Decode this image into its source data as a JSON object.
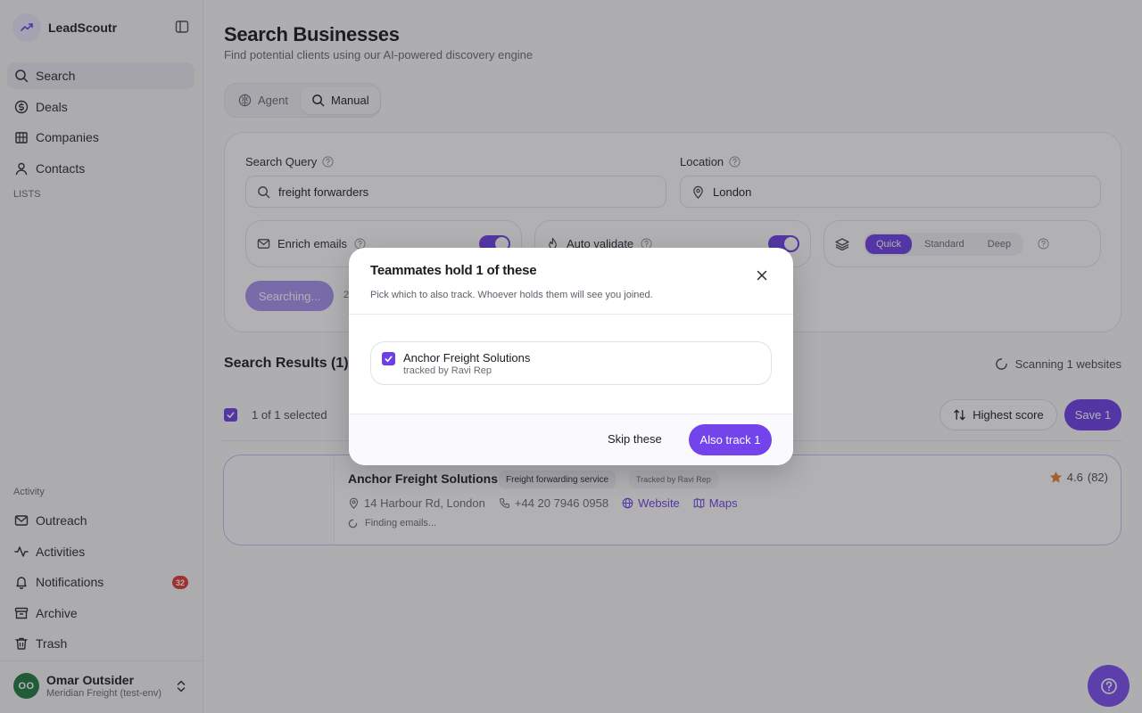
{
  "app": {
    "name": "LeadScoutr"
  },
  "sidebar": {
    "nav": [
      {
        "label": "Search",
        "icon": "search-icon"
      },
      {
        "label": "Deals",
        "icon": "dollar-icon"
      },
      {
        "label": "Companies",
        "icon": "building-icon"
      },
      {
        "label": "Contacts",
        "icon": "user-icon"
      }
    ],
    "lists_label": "LISTS",
    "activity_label": "Activity",
    "activity_items": [
      {
        "label": "Outreach",
        "icon": "mail-icon"
      },
      {
        "label": "Activities",
        "icon": "activity-icon"
      },
      {
        "label": "Notifications",
        "icon": "bell-icon",
        "badge": "32"
      },
      {
        "label": "Archive",
        "icon": "archive-icon"
      },
      {
        "label": "Trash",
        "icon": "trash-icon"
      }
    ],
    "user": {
      "initials": "OO",
      "name": "Omar Outsider",
      "org": "Meridian Freight (test-env)"
    }
  },
  "page": {
    "title": "Search Businesses",
    "subtitle": "Find potential clients using our AI-powered discovery engine"
  },
  "mode_tabs": [
    {
      "label": "Agent",
      "active": false
    },
    {
      "label": "Manual",
      "active": true
    }
  ],
  "search": {
    "query_label": "Search Query",
    "query_value": "freight forwarders",
    "location_label": "Location",
    "location_value": "London",
    "enrich_label": "Enrich emails",
    "enrich_on": true,
    "validate_label": "Auto validate",
    "validate_on": true,
    "depth_options": [
      "Quick",
      "Standard",
      "Deep"
    ],
    "depth_selected": "Quick",
    "button_label": "Searching...",
    "count_fragment": "2"
  },
  "results": {
    "title": "Search Results (1)",
    "scanning_text": "Scanning 1 websites",
    "selected_text": "1 of 1 selected",
    "sort_label": "Highest score",
    "save_label": "Save 1",
    "items": [
      {
        "name": "Anchor Freight Solutions",
        "category": "Freight forwarding service",
        "tracked": "Tracked by Ravi Rep",
        "rating": "4.6",
        "reviews": "(82)",
        "address": "14 Harbour Rd, London",
        "phone": "+44 20 7946 0958",
        "website_label": "Website",
        "maps_label": "Maps",
        "status": "Finding emails..."
      }
    ]
  },
  "modal": {
    "title": "Teammates hold 1 of these",
    "subtitle": "Pick which to also track. Whoever holds them will see you joined.",
    "items": [
      {
        "name": "Anchor Freight Solutions",
        "tracked_by": "tracked by Ravi Rep",
        "checked": true
      }
    ],
    "skip_label": "Skip these",
    "confirm_label": "Also track 1"
  },
  "colors": {
    "accent": "#6d3fe4",
    "badge": "#e0392e",
    "avatar": "#1f7a3f",
    "star": "#e8832a"
  }
}
